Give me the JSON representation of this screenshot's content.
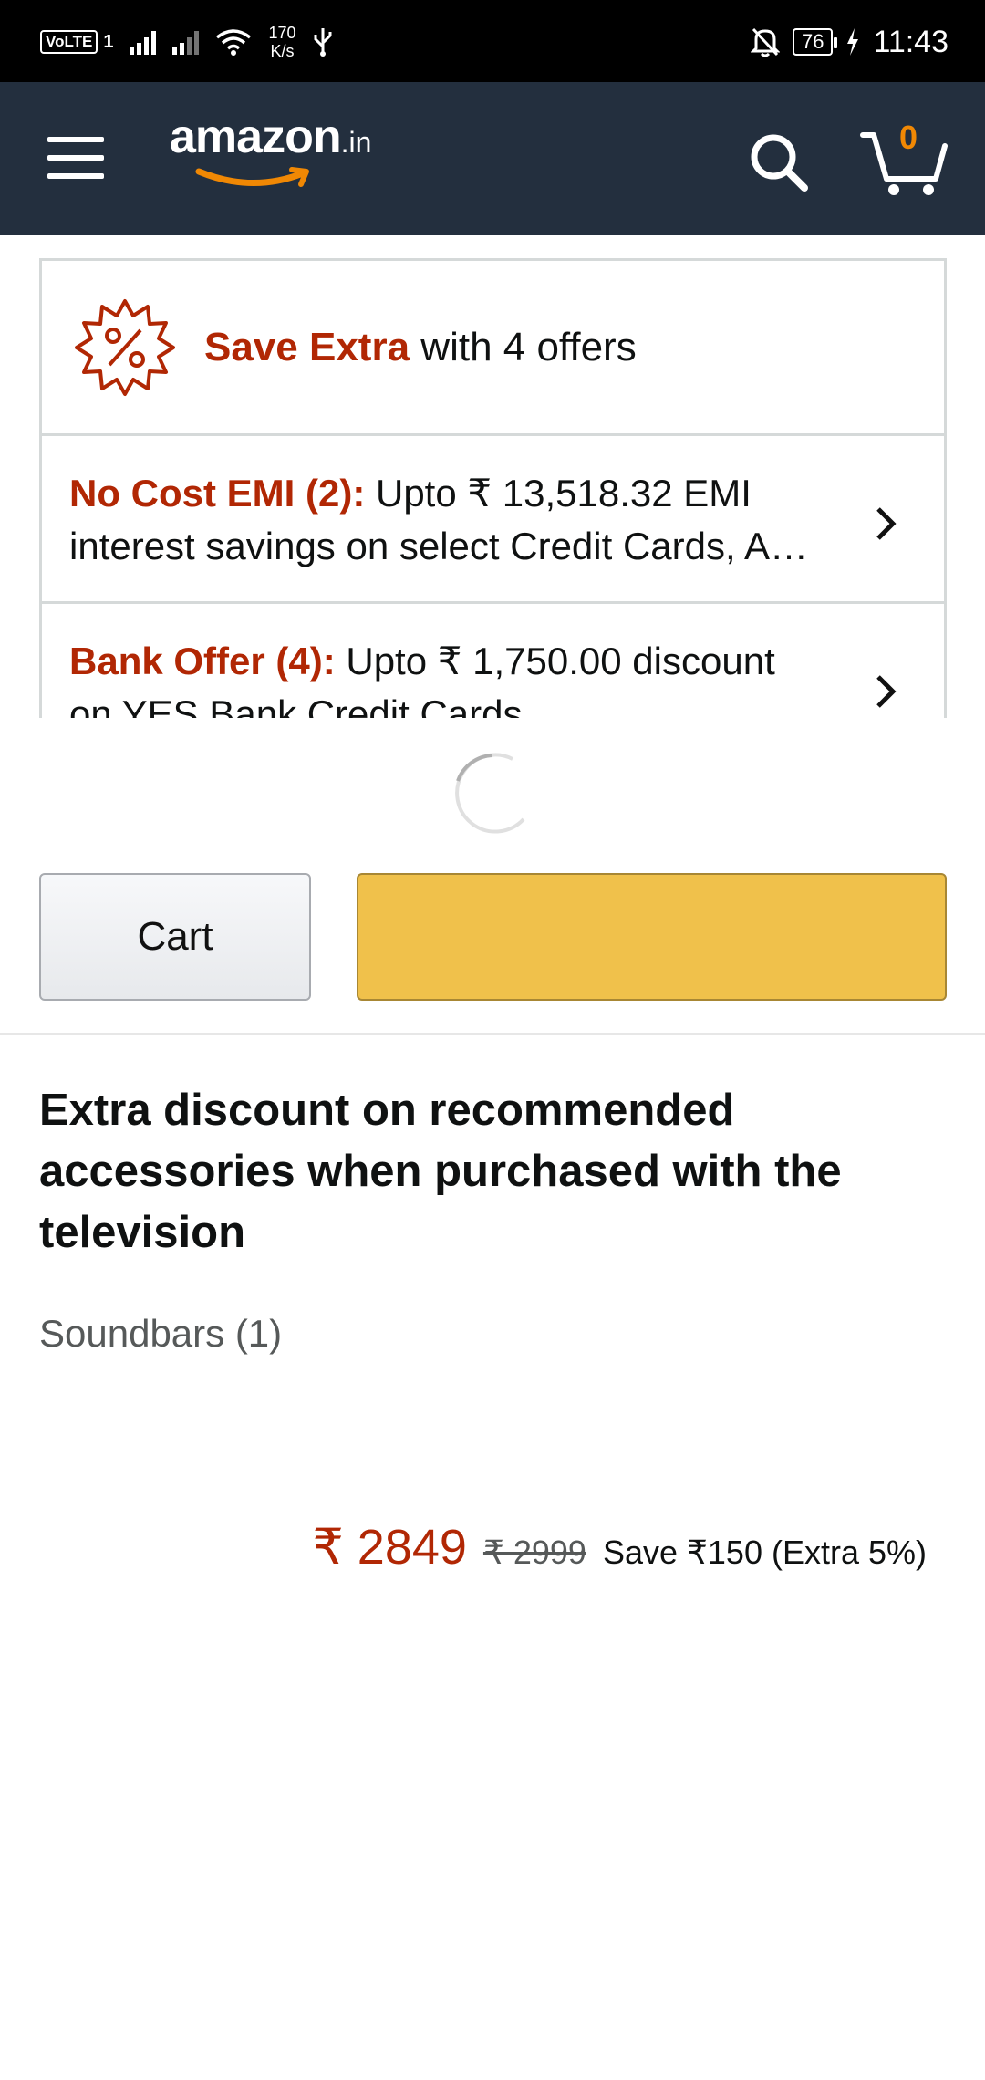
{
  "status_bar": {
    "volte": "VoLTE",
    "volte_slot": "1",
    "speed_value": "170",
    "speed_unit": "K/s",
    "battery": "76",
    "time": "11:43"
  },
  "header": {
    "logo_main": "amazon",
    "logo_tld": ".in",
    "cart_count": "0",
    "background": "#232f3e",
    "cart_count_color": "#f08804"
  },
  "offers": {
    "headline_accent": "Save Extra",
    "headline_rest": " with 4 offers",
    "rows": [
      {
        "label": "No Cost EMI (2):",
        "line1_rest": " Upto ₹ 13,518.32 EMI",
        "line2": "interest savings on select Credit Cards, A…"
      },
      {
        "label": "Bank Offer (4):",
        "line1_rest": " Upto ₹ 1,750.00 discount",
        "line2": "on YES Bank Credit Cards"
      }
    ],
    "accent_color": "#b12704"
  },
  "buttons": {
    "cart_label": "Cart",
    "buy_color": "#f0c14b"
  },
  "recommend": {
    "title": "Extra discount on recommended accessories when purchased with the television",
    "category": "Soundbars (1)",
    "price_now": "₹ 2849",
    "price_old": "₹ 2999",
    "price_save": "Save ₹150 (Extra 5%)"
  }
}
